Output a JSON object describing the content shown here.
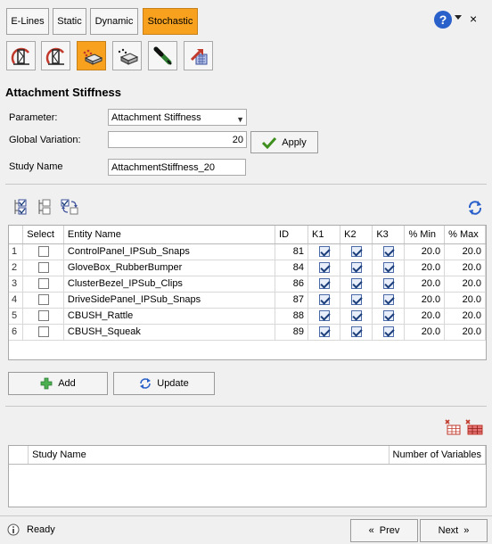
{
  "tabs": [
    {
      "label": "E-Lines",
      "active": false
    },
    {
      "label": "Static",
      "active": false
    },
    {
      "label": "Dynamic",
      "active": false
    },
    {
      "label": "Stochastic",
      "active": true
    }
  ],
  "header": {
    "help_symbol": "?",
    "close_symbol": "×"
  },
  "toolbar": [
    {
      "icon": "fatigue-gauge-icon",
      "active": false
    },
    {
      "icon": "fatigue-gauge-alt-icon",
      "active": false
    },
    {
      "icon": "attachment-points-icon",
      "active": true
    },
    {
      "icon": "stiffness-block-icon",
      "active": false
    },
    {
      "icon": "probe-tool-icon",
      "active": false
    },
    {
      "icon": "export-report-icon",
      "active": false
    }
  ],
  "section_title": "Attachment Stiffness",
  "form": {
    "parameter_label": "Parameter:",
    "parameter_value": "Attachment Stiffness",
    "global_variation_label": "Global Variation:",
    "global_variation_value": "20",
    "apply_label": "Apply",
    "study_name_label": "Study Name",
    "study_name_value": "AttachmentStiffness_20"
  },
  "table": {
    "columns": [
      "",
      "Select",
      "Entity Name",
      "ID",
      "K1",
      "K2",
      "K3",
      "% Min",
      "% Max"
    ],
    "rows": [
      {
        "n": "1",
        "name": "ControlPanel_IPSub_Snaps",
        "id": "81",
        "min": "20.0",
        "max": "20.0"
      },
      {
        "n": "2",
        "name": "GloveBox_RubberBumper",
        "id": "84",
        "min": "20.0",
        "max": "20.0"
      },
      {
        "n": "3",
        "name": "ClusterBezel_IPSub_Clips",
        "id": "86",
        "min": "20.0",
        "max": "20.0"
      },
      {
        "n": "4",
        "name": "DriveSidePanel_IPSub_Snaps",
        "id": "87",
        "min": "20.0",
        "max": "20.0"
      },
      {
        "n": "5",
        "name": "CBUSH_Rattle",
        "id": "88",
        "min": "20.0",
        "max": "20.0"
      },
      {
        "n": "6",
        "name": "CBUSH_Squeak",
        "id": "89",
        "min": "20.0",
        "max": "20.0"
      }
    ]
  },
  "actions": {
    "add_label": "Add",
    "update_label": "Update"
  },
  "studies_table": {
    "columns": [
      "",
      "Study Name",
      "Number of Variables"
    ]
  },
  "status": {
    "text": "Ready",
    "prev_label": "Prev",
    "next_label": "Next",
    "prev_glyph": "«",
    "next_glyph": "»"
  }
}
